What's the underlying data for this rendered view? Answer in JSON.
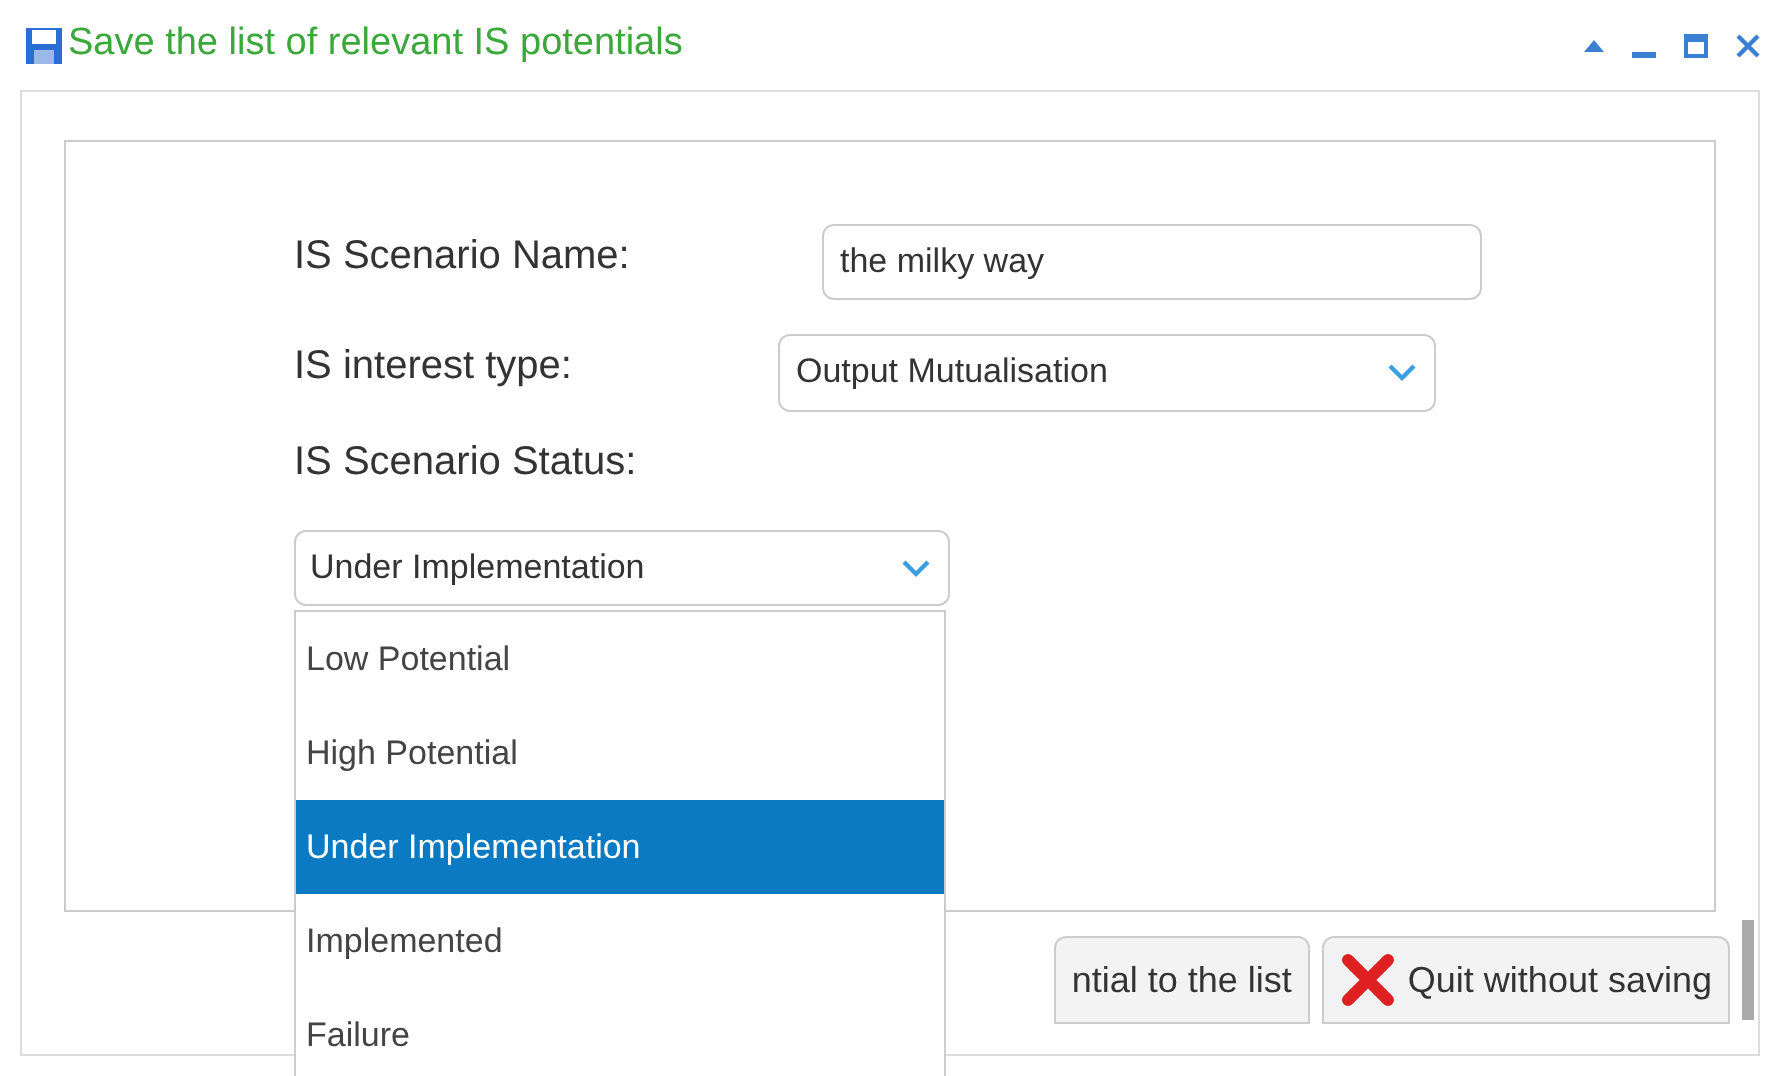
{
  "window": {
    "title": "Save the list of relevant IS potentials"
  },
  "form": {
    "name_label": "IS Scenario Name:",
    "name_value": "the milky way",
    "interest_label": "IS interest type:",
    "interest_value": "Output Mutualisation",
    "status_label": "IS Scenario Status:",
    "status_value": "Under Implementation"
  },
  "status_options": [
    {
      "label": "Low Potential",
      "selected": false
    },
    {
      "label": "High Potential",
      "selected": false
    },
    {
      "label": "Under Implementation",
      "selected": true
    },
    {
      "label": "Implemented",
      "selected": false
    },
    {
      "label": "Failure",
      "selected": false
    }
  ],
  "buttons": [
    {
      "label": "ntial to the list",
      "kind": "save"
    },
    {
      "label": "Quit without saving",
      "kind": "quit"
    }
  ]
}
